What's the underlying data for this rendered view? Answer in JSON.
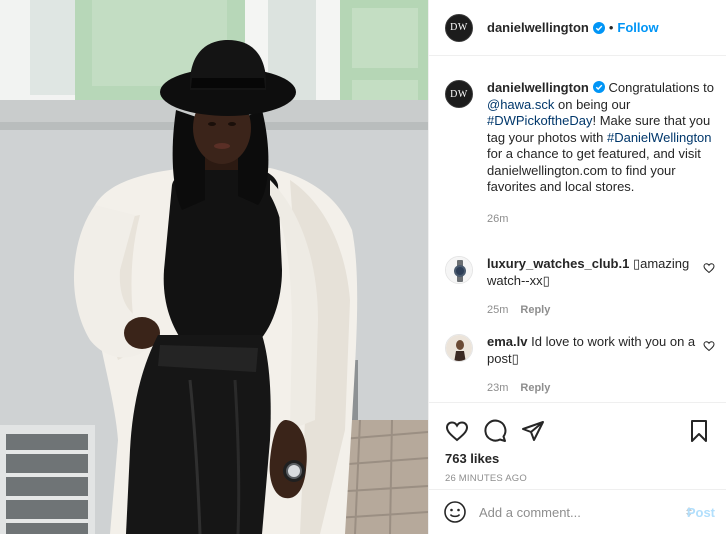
{
  "post": {
    "account": "danielwellington",
    "avatar_text": "DW",
    "follow_label": "Follow",
    "separator": "•",
    "caption": {
      "username": "danielwellington",
      "t1": "Congratulations to ",
      "mention": "@hawa.sck",
      "t2": " on being our ",
      "tag1": "#DWPickoftheDay",
      "t3": "! Make sure that you tag your photos with ",
      "tag2": "#DanielWellington",
      "t4": " for a chance to get featured, and visit danielwellington.com to find your favorites and local stores."
    },
    "caption_time": "26m"
  },
  "comments": [
    {
      "username": "luxury_watches_club.1",
      "text": "▯amazing watch--xx▯",
      "time": "25m",
      "reply_label": "Reply"
    },
    {
      "username": "ema.lv",
      "text": "Id love to work with you on a post▯",
      "time": "23m",
      "reply_label": "Reply"
    }
  ],
  "actions": {
    "likes": "763 likes",
    "time_ago": "26 MINUTES AGO",
    "icons": [
      "heart-icon",
      "comment-icon",
      "share-icon",
      "save-icon"
    ]
  },
  "add_comment": {
    "placeholder": "Add a comment...",
    "post_label": "Post"
  },
  "colors": {
    "accent": "#0095f6",
    "link": "#00376b",
    "muted": "#8e8e8e",
    "post_disabled": "#b2dffc"
  }
}
